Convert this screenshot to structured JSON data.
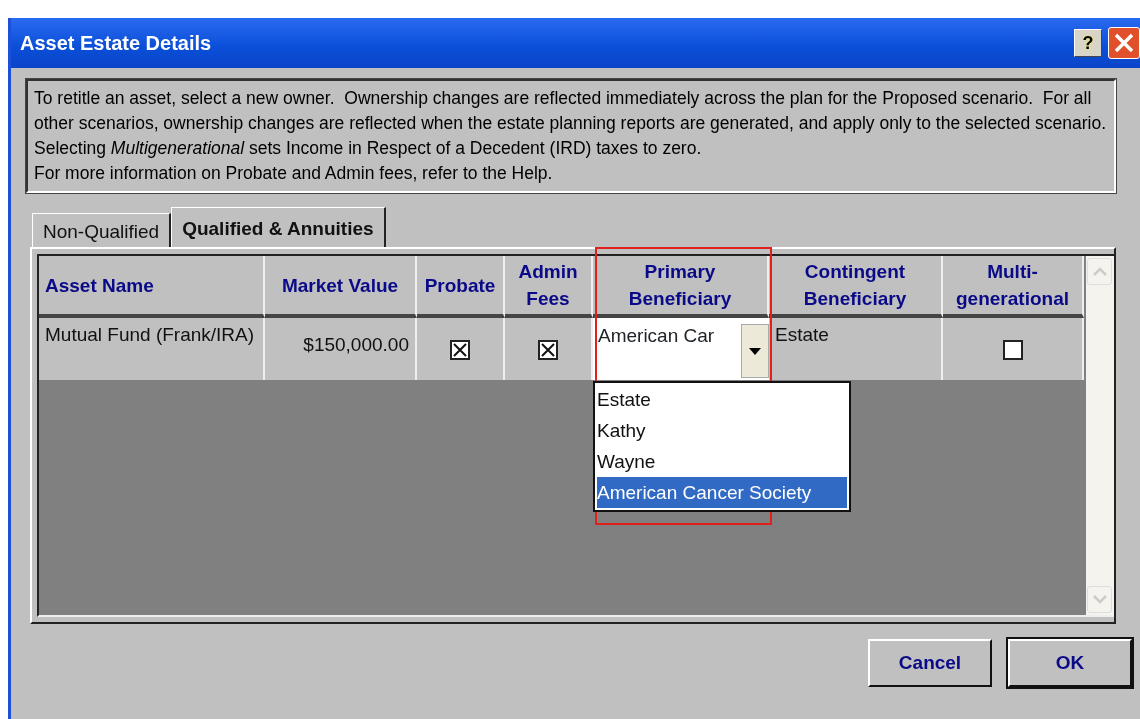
{
  "window": {
    "title": "Asset Estate Details",
    "help_button": "?"
  },
  "description": [
    "To retitle an asset, select a new owner.  Ownership changes are reflected immediately across the plan for the Proposed scenario.  For all other scenarios, ownership changes are reflected when the estate planning reports are generated, and apply only to the selected scenario.",
    "Selecting *Multigenerational* sets Income in Respect of a Decedent (IRD) taxes to zero.",
    "For more information on Probate and Admin fees, refer to the Help."
  ],
  "tabs": [
    {
      "label": "Non-Qualified",
      "selected": false
    },
    {
      "label": "Qualified & Annuities",
      "selected": true
    }
  ],
  "table": {
    "columns": [
      "Asset Name",
      "Market Value",
      "Probate",
      "Admin Fees",
      "Primary Beneficiary",
      "Contingent Beneficiary",
      "Multi-generational"
    ],
    "rows": [
      {
        "asset_name": "Mutual Fund (Frank/IRA)",
        "market_value": "$150,000.00",
        "probate": true,
        "admin_fees": true,
        "primary_beneficiary": "American Car",
        "contingent_beneficiary": "Estate",
        "multigenerational": false
      }
    ]
  },
  "dropdown": {
    "options": [
      {
        "label": "Estate",
        "selected": false
      },
      {
        "label": "Kathy",
        "selected": false
      },
      {
        "label": "Wayne",
        "selected": false
      },
      {
        "label": "American Cancer Society",
        "selected": true
      }
    ]
  },
  "buttons": [
    "Cancel",
    "OK"
  ]
}
